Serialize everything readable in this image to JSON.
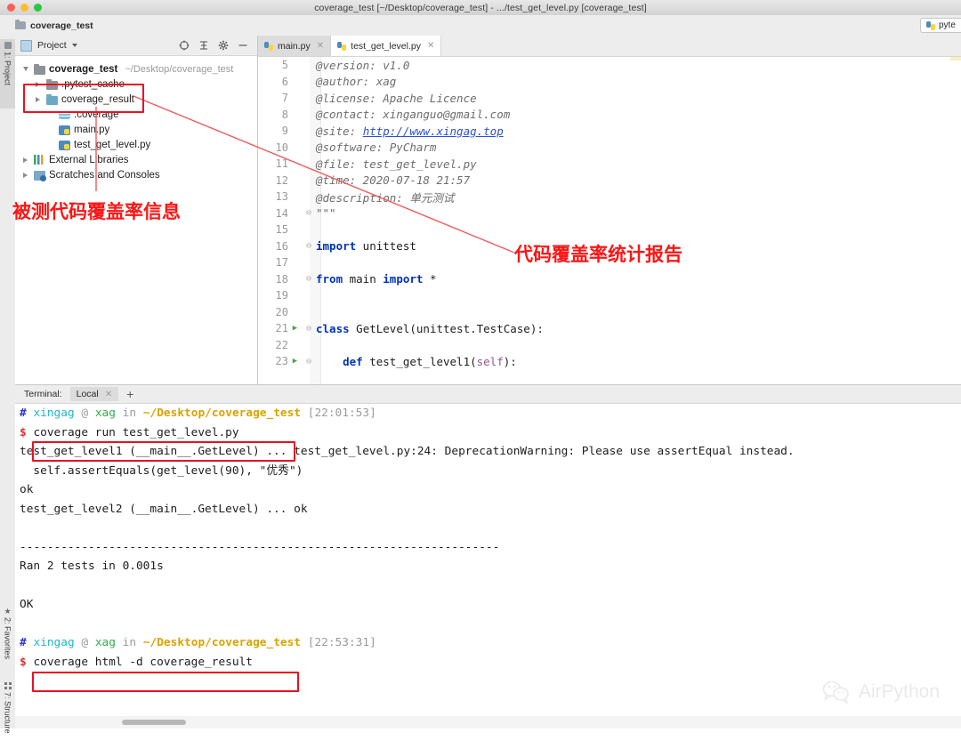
{
  "window": {
    "title": "coverage_test [~/Desktop/coverage_test] - .../test_get_level.py [coverage_test]",
    "breadcrumb": "coverage_test",
    "run_config": "pyte"
  },
  "tool_strip": {
    "project": "1: Project",
    "favorites": "2: Favorites",
    "structure": "7: Structure"
  },
  "project_panel": {
    "header_label": "Project",
    "tree": [
      {
        "label": "coverage_test",
        "path": "~/Desktop/coverage_test",
        "icon": "folder-icon",
        "arrow": "down",
        "indent": 0,
        "bold": true
      },
      {
        "label": ".pytest_cache",
        "path": "",
        "icon": "folder-icon",
        "arrow": "right",
        "indent": 1,
        "bold": false
      },
      {
        "label": "coverage_result",
        "path": "",
        "icon": "source-folder-icon",
        "arrow": "right",
        "indent": 1,
        "bold": false
      },
      {
        "label": ".coverage",
        "path": "",
        "icon": "database-icon",
        "arrow": "none",
        "indent": 2,
        "bold": false
      },
      {
        "label": "main.py",
        "path": "",
        "icon": "python-file-icon",
        "arrow": "none",
        "indent": 2,
        "bold": false
      },
      {
        "label": "test_get_level.py",
        "path": "",
        "icon": "python-file-icon",
        "arrow": "none",
        "indent": 2,
        "bold": false
      },
      {
        "label": "External Libraries",
        "path": "",
        "icon": "libraries-icon",
        "arrow": "right",
        "indent": 0,
        "bold": false
      },
      {
        "label": "Scratches and Consoles",
        "path": "",
        "icon": "scratches-icon",
        "arrow": "right",
        "indent": 0,
        "bold": false
      }
    ]
  },
  "editor": {
    "tabs": [
      {
        "label": "main.py",
        "active": false
      },
      {
        "label": "test_get_level.py",
        "active": true
      }
    ],
    "lines": [
      {
        "num": "5",
        "run": false,
        "fold": "",
        "text": "@version: v1.0",
        "style": "docstr"
      },
      {
        "num": "6",
        "run": false,
        "fold": "",
        "text": "@author: xag",
        "style": "docstr"
      },
      {
        "num": "7",
        "run": false,
        "fold": "",
        "text": "@license: Apache Licence",
        "style": "docstr"
      },
      {
        "num": "8",
        "run": false,
        "fold": "",
        "text": "@contact: xinganguo@gmail.com",
        "style": "docstr"
      },
      {
        "num": "9",
        "run": false,
        "fold": "",
        "text": "@site: ",
        "style": "docstr",
        "link": "http://www.xingag.top"
      },
      {
        "num": "10",
        "run": false,
        "fold": "",
        "text": "@software: PyCharm",
        "style": "docstr"
      },
      {
        "num": "11",
        "run": false,
        "fold": "",
        "text": "@file: test_get_level.py",
        "style": "docstr"
      },
      {
        "num": "12",
        "run": false,
        "fold": "",
        "text": "@time: 2020-07-18 21:57",
        "style": "docstr"
      },
      {
        "num": "13",
        "run": false,
        "fold": "",
        "text": "@description: 单元测试",
        "style": "docstr"
      },
      {
        "num": "14",
        "run": false,
        "fold": "end",
        "text": "\"\"\"",
        "style": "docstr"
      },
      {
        "num": "15",
        "run": false,
        "fold": "",
        "text": "",
        "style": "plain"
      },
      {
        "num": "16",
        "run": false,
        "fold": "end",
        "text": "import unittest",
        "style": "import"
      },
      {
        "num": "17",
        "run": false,
        "fold": "",
        "text": "",
        "style": "plain"
      },
      {
        "num": "18",
        "run": false,
        "fold": "end",
        "text": "from main import *",
        "style": "from"
      },
      {
        "num": "19",
        "run": false,
        "fold": "",
        "text": "",
        "style": "plain"
      },
      {
        "num": "20",
        "run": false,
        "fold": "",
        "text": "",
        "style": "plain"
      },
      {
        "num": "21",
        "run": true,
        "fold": "end",
        "text": "class GetLevel(unittest.TestCase):",
        "style": "class"
      },
      {
        "num": "22",
        "run": false,
        "fold": "",
        "text": "",
        "style": "plain"
      },
      {
        "num": "23",
        "run": true,
        "fold": "mid",
        "text": "    def test_get_level1(self):",
        "style": "def"
      }
    ]
  },
  "terminal": {
    "label": "Terminal:",
    "tab": "Local",
    "add_tab": "+",
    "blocks": [
      {
        "type": "prompt",
        "user": "xingag",
        "at": "@",
        "host": "xag",
        "in": "in",
        "path": "~/Desktop/coverage_test",
        "time": "[22:01:53]"
      },
      {
        "type": "command",
        "text": "coverage run test_get_level.py",
        "boxed": true
      },
      {
        "type": "plain",
        "text": "test_get_level1 (__main__.GetLevel) ... test_get_level.py:24: DeprecationWarning: Please use assertEqual instead."
      },
      {
        "type": "plain",
        "text": "  self.assertEquals(get_level(90), \"优秀\")"
      },
      {
        "type": "plain",
        "text": "ok"
      },
      {
        "type": "plain",
        "text": "test_get_level2 (__main__.GetLevel) ... ok"
      },
      {
        "type": "plain",
        "text": ""
      },
      {
        "type": "plain",
        "text": "----------------------------------------------------------------------"
      },
      {
        "type": "plain",
        "text": "Ran 2 tests in 0.001s"
      },
      {
        "type": "plain",
        "text": ""
      },
      {
        "type": "plain",
        "text": "OK"
      },
      {
        "type": "plain",
        "text": ""
      },
      {
        "type": "prompt",
        "user": "xingag",
        "at": "@",
        "host": "xag",
        "in": "in",
        "path": "~/Desktop/coverage_test",
        "time": "[22:53:31]"
      },
      {
        "type": "command",
        "text": "coverage html -d coverage_result",
        "boxed": true
      }
    ]
  },
  "annotations": {
    "accent_color": "#ff1414",
    "box_color": "#e81123",
    "label_tree": "被测代码覆盖率信息",
    "label_report": "代码覆盖率统计报告"
  },
  "watermark": {
    "text": "AirPython",
    "icon": "wechat-icon"
  }
}
